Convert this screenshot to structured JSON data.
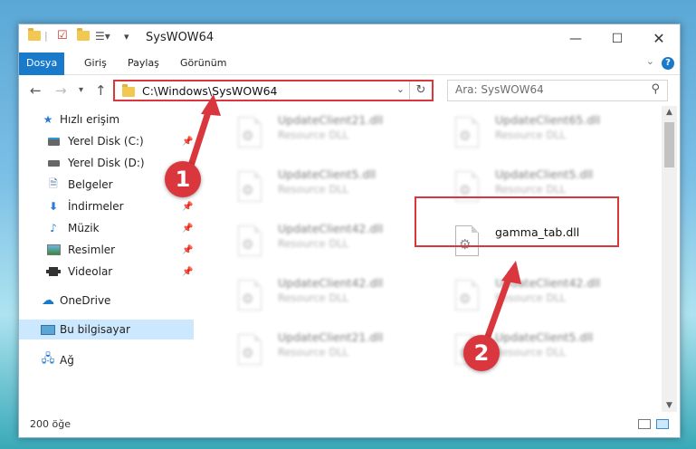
{
  "window": {
    "title": "SysWOW64"
  },
  "ribbon": {
    "tabs": [
      "Dosya",
      "Giriş",
      "Paylaş",
      "Görünüm"
    ],
    "help": "?"
  },
  "navbar": {
    "address": "C:\\Windows\\SysWOW64",
    "search_placeholder": "Ara: SysWOW64"
  },
  "sidebar": {
    "items": [
      {
        "label": "Hızlı erişim",
        "icon": "star-icon"
      },
      {
        "label": "Yerel Disk (C:)",
        "icon": "drive-icon"
      },
      {
        "label": "Yerel Disk (D:)",
        "icon": "drive-icon"
      },
      {
        "label": "Belgeler",
        "icon": "documents-icon"
      },
      {
        "label": "İndirmeler",
        "icon": "download-icon"
      },
      {
        "label": "Müzik",
        "icon": "music-icon"
      },
      {
        "label": "Resimler",
        "icon": "pictures-icon"
      },
      {
        "label": "Videolar",
        "icon": "video-icon"
      },
      {
        "label": "OneDrive",
        "icon": "cloud-icon"
      },
      {
        "label": "Bu bilgisayar",
        "icon": "computer-icon"
      },
      {
        "label": "Ağ",
        "icon": "network-icon"
      }
    ],
    "selected": "Bu bilgisayar"
  },
  "files": [
    {
      "name": "UpdateClient21.dll",
      "desc": "Resource DLL"
    },
    {
      "name": "UpdateClient65.dll",
      "desc": "Resource DLL"
    },
    {
      "name": "UpdateClient5.dll",
      "desc": "Resource DLL"
    },
    {
      "name": "UpdateClient5.dll",
      "desc": "Resource DLL"
    },
    {
      "name": "UpdateClient42.dll",
      "desc": "Resource DLL"
    },
    {
      "name": "gamma_tab.dll",
      "desc": ""
    },
    {
      "name": "UpdateClient42.dll",
      "desc": "Resource DLL"
    },
    {
      "name": "UpdateClient42.dll",
      "desc": "Resource DLL"
    },
    {
      "name": "UpdateClient21.dll",
      "desc": "Resource DLL"
    },
    {
      "name": "UpdateClient5.dll",
      "desc": "Resource DLL"
    }
  ],
  "status": {
    "item_count": "200 öğe"
  },
  "annotations": {
    "badge1": "1",
    "badge2": "2",
    "color": "#d9363e"
  }
}
